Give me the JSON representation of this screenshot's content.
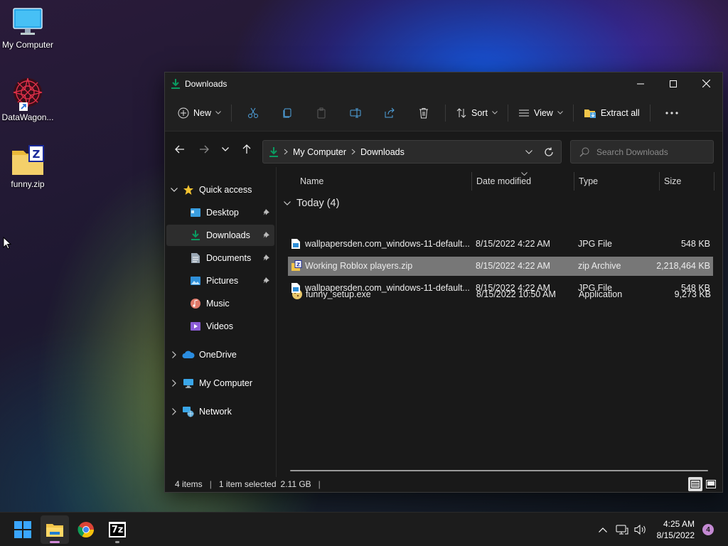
{
  "desktop": {
    "icons": [
      {
        "label": "My Computer",
        "icon": "monitor-icon"
      },
      {
        "label": "DataWagon...",
        "icon": "datawagon-app-icon"
      },
      {
        "label": "funny.zip",
        "icon": "zip-archive-icon"
      }
    ]
  },
  "window": {
    "title": "Downloads",
    "toolbar": {
      "new_label": "New",
      "sort_label": "Sort",
      "view_label": "View",
      "extract_label": "Extract all"
    },
    "address": {
      "crumbs": [
        "My Computer",
        "Downloads"
      ],
      "search_placeholder": "Search Downloads"
    },
    "nav": {
      "quick_access": "Quick access",
      "items": [
        "Desktop",
        "Downloads",
        "Documents",
        "Pictures",
        "Music",
        "Videos"
      ],
      "onedrive": "OneDrive",
      "my_computer": "My Computer",
      "network": "Network"
    },
    "columns": {
      "name": "Name",
      "date": "Date modified",
      "type": "Type",
      "size": "Size"
    },
    "group_label": "Today (4)",
    "files": [
      {
        "name": "funny_setup.exe",
        "date": "8/15/2022 10:50 AM",
        "type": "Application",
        "size": "9,273 KB"
      },
      {
        "name": "wallpapersden.com_windows-11-default...",
        "date": "8/15/2022 4:22 AM",
        "type": "JPG File",
        "size": "548 KB"
      },
      {
        "name": "Working Roblox players.zip",
        "date": "8/15/2022 4:22 AM",
        "type": "zip Archive",
        "size": "2,218,464 KB"
      },
      {
        "name": "wallpapersden.com_windows-11-default...",
        "date": "8/15/2022 4:22 AM",
        "type": "JPG File",
        "size": "548 KB"
      }
    ],
    "status": {
      "items": "4 items",
      "selected": "1 item selected",
      "size": "2.11 GB"
    }
  },
  "taskbar": {
    "clock_time": "4:25 AM",
    "clock_date": "8/15/2022",
    "notification_count": "4",
    "sevenzip_label": "7z"
  },
  "colors": {
    "accent": "#0a9a60",
    "selection": "#777777",
    "folder": "#f2c54a"
  }
}
